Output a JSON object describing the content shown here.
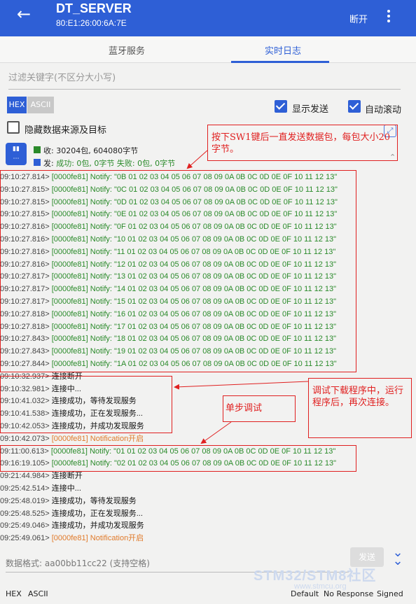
{
  "appbar": {
    "back_icon": "arrow-left-icon",
    "title": "DT_SERVER",
    "subtitle": "80:E1:26:00:6A:7E",
    "disconnect": "断开",
    "more_icon": "more-vert-icon"
  },
  "tabs": [
    {
      "label": "蓝牙服务"
    },
    {
      "label": "实时日志"
    }
  ],
  "filter": {
    "placeholder": "过滤关键字(不区分大小写)"
  },
  "format_top": {
    "hex": "HEX",
    "ascii": "ASCII"
  },
  "options": {
    "show_send": "显示发送",
    "auto_scroll": "自动滚动",
    "hide_source": "隐藏数据来源及目标"
  },
  "stats": {
    "recv": "收: 30204包, 604080字节",
    "send_prefix": "发: ",
    "send_detail": "成功: 0包, 0字节 失败: 0包, 0字节"
  },
  "logs": [
    {
      "t": "09:10:27.814>",
      "m": "[0000fe81] Notify: \"0B 01 02 03 04 05 06 07 08 09 0A 0B 0C 0D 0E 0F 10 11 12 13\"",
      "k": "notify"
    },
    {
      "t": "09:10:27.815>",
      "m": "[0000fe81] Notify: \"0C 01 02 03 04 05 06 07 08 09 0A 0B 0C 0D 0E 0F 10 11 12 13\"",
      "k": "notify"
    },
    {
      "t": "09:10:27.815>",
      "m": "[0000fe81] Notify: \"0D 01 02 03 04 05 06 07 08 09 0A 0B 0C 0D 0E 0F 10 11 12 13\"",
      "k": "notify"
    },
    {
      "t": "09:10:27.815>",
      "m": "[0000fe81] Notify: \"0E 01 02 03 04 05 06 07 08 09 0A 0B 0C 0D 0E 0F 10 11 12 13\"",
      "k": "notify"
    },
    {
      "t": "09:10:27.816>",
      "m": "[0000fe81] Notify: \"0F 01 02 03 04 05 06 07 08 09 0A 0B 0C 0D 0E 0F 10 11 12 13\"",
      "k": "notify"
    },
    {
      "t": "09:10:27.816>",
      "m": "[0000fe81] Notify: \"10 01 02 03 04 05 06 07 08 09 0A 0B 0C 0D 0E 0F 10 11 12 13\"",
      "k": "notify"
    },
    {
      "t": "09:10:27.816>",
      "m": "[0000fe81] Notify: \"11 01 02 03 04 05 06 07 08 09 0A 0B 0C 0D 0E 0F 10 11 12 13\"",
      "k": "notify"
    },
    {
      "t": "09:10:27.816>",
      "m": "[0000fe81] Notify: \"12 01 02 03 04 05 06 07 08 09 0A 0B 0C 0D 0E 0F 10 11 12 13\"",
      "k": "notify"
    },
    {
      "t": "09:10:27.817>",
      "m": "[0000fe81] Notify: \"13 01 02 03 04 05 06 07 08 09 0A 0B 0C 0D 0E 0F 10 11 12 13\"",
      "k": "notify"
    },
    {
      "t": "09:10:27.817>",
      "m": "[0000fe81] Notify: \"14 01 02 03 04 05 06 07 08 09 0A 0B 0C 0D 0E 0F 10 11 12 13\"",
      "k": "notify"
    },
    {
      "t": "09:10:27.817>",
      "m": "[0000fe81] Notify: \"15 01 02 03 04 05 06 07 08 09 0A 0B 0C 0D 0E 0F 10 11 12 13\"",
      "k": "notify"
    },
    {
      "t": "09:10:27.818>",
      "m": "[0000fe81] Notify: \"16 01 02 03 04 05 06 07 08 09 0A 0B 0C 0D 0E 0F 10 11 12 13\"",
      "k": "notify"
    },
    {
      "t": "09:10:27.818>",
      "m": "[0000fe81] Notify: \"17 01 02 03 04 05 06 07 08 09 0A 0B 0C 0D 0E 0F 10 11 12 13\"",
      "k": "notify"
    },
    {
      "t": "09:10:27.843>",
      "m": "[0000fe81] Notify: \"18 01 02 03 04 05 06 07 08 09 0A 0B 0C 0D 0E 0F 10 11 12 13\"",
      "k": "notify"
    },
    {
      "t": "09:10:27.843>",
      "m": "[0000fe81] Notify: \"19 01 02 03 04 05 06 07 08 09 0A 0B 0C 0D 0E 0F 10 11 12 13\"",
      "k": "notify"
    },
    {
      "t": "09:10:27.844>",
      "m": "[0000fe81] Notify: \"1A 01 02 03 04 05 06 07 08 09 0A 0B 0C 0D 0E 0F 10 11 12 13\"",
      "k": "notify"
    },
    {
      "t": "09:10:32.937>",
      "m": "连接断开",
      "k": "status"
    },
    {
      "t": "09:10:32.981>",
      "m": "连接中...",
      "k": "status"
    },
    {
      "t": "09:10:41.032>",
      "m": "连接成功，等待发现服务",
      "k": "status"
    },
    {
      "t": "09:10:41.538>",
      "m": "连接成功，正在发现服务...",
      "k": "status"
    },
    {
      "t": "09:10:42.053>",
      "m": "连接成功，并成功发现服务",
      "k": "status"
    },
    {
      "t": "09:10:42.073>",
      "m": "[0000fe81] Notification开启",
      "k": "open"
    },
    {
      "t": "09:11:00.613>",
      "m": "[0000fe81] Notify: \"01 01 02 03 04 05 06 07 08 09 0A 0B 0C 0D 0E 0F 10 11 12 13\"",
      "k": "notify"
    },
    {
      "t": "09:16:19.105>",
      "m": "[0000fe81] Notify: \"02 01 02 03 04 05 06 07 08 09 0A 0B 0C 0D 0E 0F 10 11 12 13\"",
      "k": "notify"
    },
    {
      "t": "09:21:44.984>",
      "m": "连接断开",
      "k": "status"
    },
    {
      "t": "09:25:42.514>",
      "m": "连接中...",
      "k": "status"
    },
    {
      "t": "09:25:48.019>",
      "m": "连接成功，等待发现服务",
      "k": "status"
    },
    {
      "t": "09:25:48.525>",
      "m": "连接成功，正在发现服务...",
      "k": "status"
    },
    {
      "t": "09:25:49.046>",
      "m": "连接成功，并成功发现服务",
      "k": "status"
    },
    {
      "t": "09:25:49.061>",
      "m": "[0000fe81] Notification开启",
      "k": "open"
    }
  ],
  "annotations": {
    "note1": "按下SW1键后一直发送数据包，每包大小20字节。",
    "note2": "调试下载程序中，运行程序后，再次连接。",
    "note3": "单步调试"
  },
  "input": {
    "placeholder": "数据格式: aa00bb11cc22 (支持空格)",
    "send": "发送",
    "expand_icon": "double-chevron-down-icon"
  },
  "format_bottom": {
    "hex": "HEX",
    "ascii": "ASCII"
  },
  "write_modes": {
    "default": "Default",
    "no_response": "No Response",
    "signed": "Signed"
  },
  "watermark": {
    "main": "STM32/STM8社区",
    "sub": "www.stmcu.org"
  },
  "colors": {
    "primary": "#2e5fd6",
    "notify": "#2a8a2a",
    "annotation": "#e02020",
    "notification_open": "#e07a2a"
  }
}
